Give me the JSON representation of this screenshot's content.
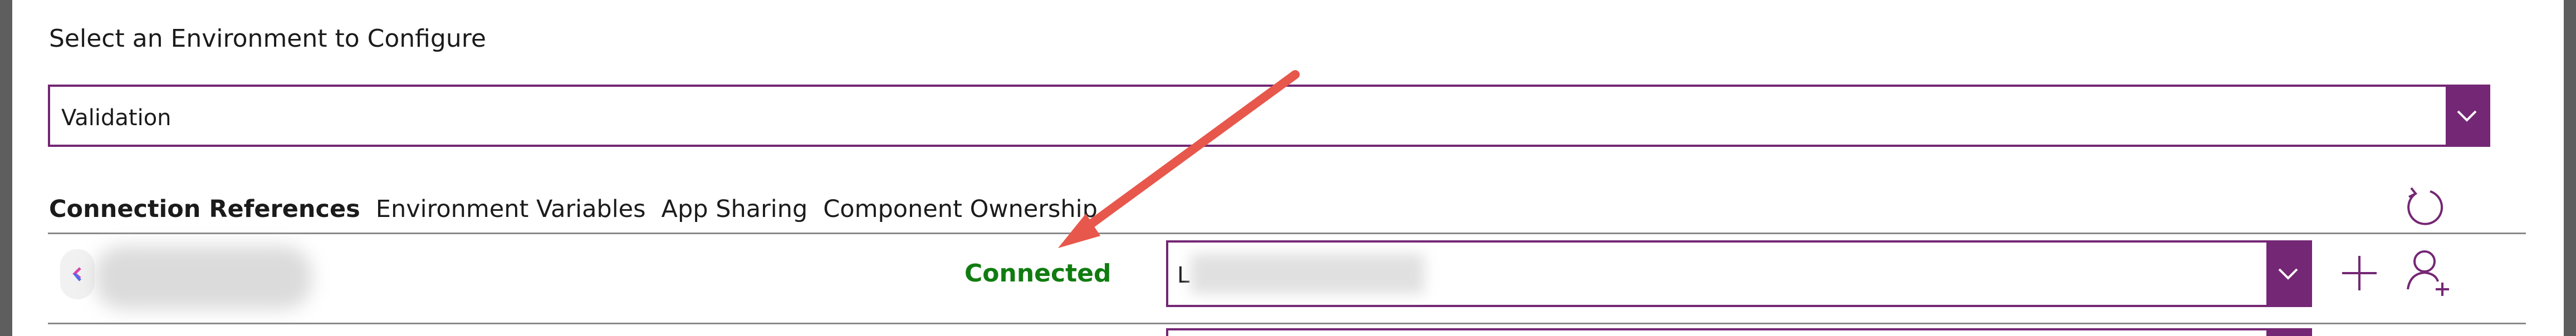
{
  "header": {
    "title": "Select an Environment to Configure"
  },
  "environment": {
    "selected": "Validation"
  },
  "tabs": [
    {
      "label": "Connection References",
      "active": true
    },
    {
      "label": "Environment Variables",
      "active": false
    },
    {
      "label": "App Sharing",
      "active": false
    },
    {
      "label": "Component Ownership",
      "active": false
    }
  ],
  "rows": [
    {
      "status": "Connected",
      "connection_prefix": "L"
    }
  ],
  "colors": {
    "accent": "#742774",
    "connected": "#107c10",
    "annotation_arrow": "#e8574b"
  },
  "icons": {
    "refresh": "refresh-icon",
    "dropdown": "chevron-down-icon",
    "add": "plus-icon",
    "user_add": "add-user-icon"
  }
}
